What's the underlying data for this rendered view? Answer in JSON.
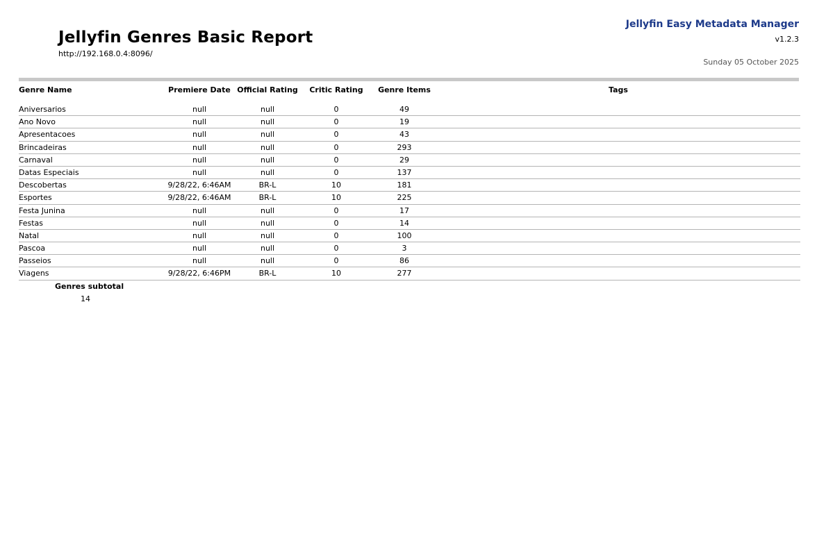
{
  "header": {
    "title": "Jellyfin Genres Basic Report",
    "server_url": "http://192.168.0.4:8096/",
    "app_name": "Jellyfin Easy Metadata Manager",
    "version": "v1.2.3",
    "date": "Sunday 05 October 2025"
  },
  "table": {
    "columns": {
      "genre_name": "Genre Name",
      "premiere_date": "Premiere Date",
      "official_rating": "Official Rating",
      "critic_rating": "Critic Rating",
      "genre_items": "Genre Items",
      "tags": "Tags"
    },
    "rows": [
      {
        "name": "Aniversarios",
        "date": "null",
        "rating": "null",
        "critic": "0",
        "items": "49",
        "tags": ""
      },
      {
        "name": "Ano Novo",
        "date": "null",
        "rating": "null",
        "critic": "0",
        "items": "19",
        "tags": ""
      },
      {
        "name": "Apresentacoes",
        "date": "null",
        "rating": "null",
        "critic": "0",
        "items": "43",
        "tags": ""
      },
      {
        "name": "Brincadeiras",
        "date": "null",
        "rating": "null",
        "critic": "0",
        "items": "293",
        "tags": ""
      },
      {
        "name": "Carnaval",
        "date": "null",
        "rating": "null",
        "critic": "0",
        "items": "29",
        "tags": ""
      },
      {
        "name": "Datas Especiais",
        "date": "null",
        "rating": "null",
        "critic": "0",
        "items": "137",
        "tags": ""
      },
      {
        "name": "Descobertas",
        "date": "9/28/22, 6:46AM",
        "rating": "BR-L",
        "critic": "10",
        "items": "181",
        "tags": ""
      },
      {
        "name": "Esportes",
        "date": "9/28/22, 6:46AM",
        "rating": "BR-L",
        "critic": "10",
        "items": "225",
        "tags": ""
      },
      {
        "name": "Festa Junina",
        "date": "null",
        "rating": "null",
        "critic": "0",
        "items": "17",
        "tags": ""
      },
      {
        "name": "Festas",
        "date": "null",
        "rating": "null",
        "critic": "0",
        "items": "14",
        "tags": ""
      },
      {
        "name": "Natal",
        "date": "null",
        "rating": "null",
        "critic": "0",
        "items": "100",
        "tags": ""
      },
      {
        "name": "Pascoa",
        "date": "null",
        "rating": "null",
        "critic": "0",
        "items": "3",
        "tags": ""
      },
      {
        "name": "Passeios",
        "date": "null",
        "rating": "null",
        "critic": "0",
        "items": "86",
        "tags": ""
      },
      {
        "name": "Viagens",
        "date": "9/28/22, 6:46PM",
        "rating": "BR-L",
        "critic": "10",
        "items": "277",
        "tags": ""
      }
    ]
  },
  "subtotal": {
    "label": "Genres subtotal",
    "value": "14"
  },
  "colors": {
    "app_name": "#1d3a8a",
    "header_rule": "#c8c8c8",
    "row_line": "#b4b4b4"
  }
}
